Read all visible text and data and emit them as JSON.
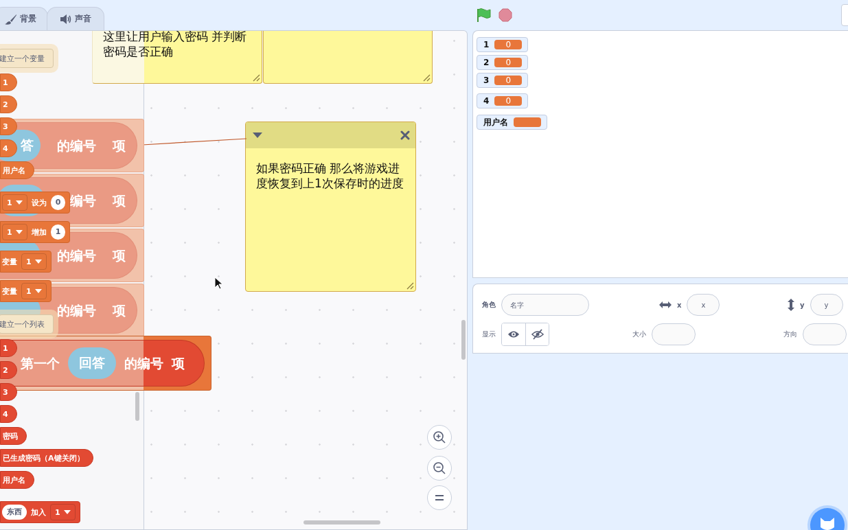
{
  "tabs": [
    {
      "label": "背景",
      "selected": false
    },
    {
      "label": "声音",
      "selected": false
    }
  ],
  "palette": {
    "items": [
      {
        "kind": "button",
        "label": "建立一个变量"
      },
      {
        "kind": "var_reporter",
        "label": "1"
      },
      {
        "kind": "var_reporter",
        "label": "2"
      },
      {
        "kind": "var_reporter",
        "label": "3"
      },
      {
        "kind": "var_reporter",
        "label": "4"
      },
      {
        "kind": "var_reporter",
        "label": "用户名"
      },
      {
        "kind": "set",
        "variable": "1",
        "verb": "设为",
        "value": "0"
      },
      {
        "kind": "set",
        "variable": "1",
        "verb": "增加",
        "value": "1"
      },
      {
        "kind": "show",
        "label": "变量",
        "variable": "1"
      },
      {
        "kind": "show",
        "label": "变量",
        "variable": "1"
      },
      {
        "kind": "button",
        "label": "建立一个列表"
      },
      {
        "kind": "list_reporter",
        "label": "1"
      },
      {
        "kind": "list_reporter",
        "label": "2"
      },
      {
        "kind": "list_reporter",
        "label": "3"
      },
      {
        "kind": "list_reporter",
        "label": "4"
      },
      {
        "kind": "list_reporter",
        "label": "密码"
      },
      {
        "kind": "list_reporter",
        "label": "已生成密码（A键关闭）"
      },
      {
        "kind": "list_reporter",
        "label": "用户名"
      },
      {
        "kind": "add",
        "value": "东西",
        "verb": "加入",
        "variable": "1"
      }
    ]
  },
  "workspace": {
    "notes": [
      {
        "kind": "plain",
        "text": "这里让用户输入密码 并判断密码是否正确"
      },
      {
        "kind": "plain"
      },
      {
        "kind": "header",
        "text": "如果密码正确 那么将游戏进度恢复到上1次保存时的进度"
      }
    ],
    "blocks": [
      {
        "kind": "short",
        "parts": [
          {
            "kind": "oval",
            "text": "答"
          },
          {
            "kind": "text",
            "text": "的编号"
          },
          {
            "kind": "text",
            "text": "项"
          }
        ]
      },
      {
        "kind": "short",
        "parts": [
          {
            "kind": "oval"
          },
          {
            "kind": "text",
            "text": "编号"
          },
          {
            "kind": "text",
            "text": "项"
          }
        ]
      },
      {
        "kind": "short",
        "parts": [
          {
            "kind": "oval"
          },
          {
            "kind": "text",
            "text": "的编号"
          },
          {
            "kind": "text",
            "text": "项"
          }
        ]
      },
      {
        "kind": "short",
        "parts": [
          {
            "kind": "oval"
          },
          {
            "kind": "text",
            "text": "的编号"
          },
          {
            "kind": "text",
            "text": "项"
          }
        ]
      },
      {
        "kind": "long",
        "parts": [
          {
            "kind": "text",
            "text": "第一个"
          },
          {
            "kind": "oval",
            "text": "回答"
          },
          {
            "kind": "text",
            "text": "的编号"
          },
          {
            "kind": "text",
            "text": "项"
          }
        ]
      }
    ]
  },
  "stage": {
    "monitors": [
      {
        "label": "1",
        "value": "0"
      },
      {
        "label": "2",
        "value": "0"
      },
      {
        "label": "3",
        "value": "0"
      },
      {
        "label": "4",
        "value": "0"
      },
      {
        "label": "用户名"
      }
    ]
  },
  "sprite_info": {
    "sprite_label": "角色",
    "name_placeholder": "名字",
    "x_label": "x",
    "x_placeholder": "x",
    "y_label": "y",
    "y_placeholder": "y",
    "show_label": "显示",
    "size_label": "大小",
    "direction_label": "方向"
  }
}
